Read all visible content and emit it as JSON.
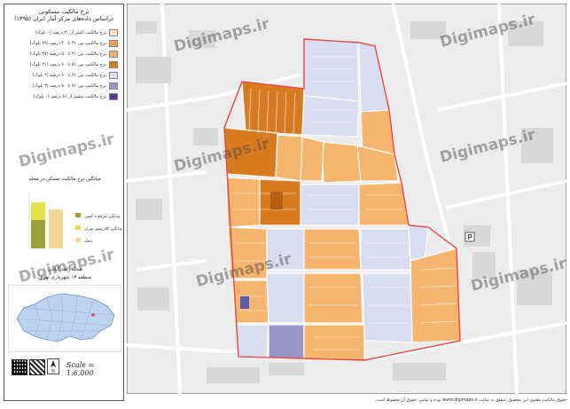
{
  "legend": {
    "title_line1": "نرخ مالکیت مسکونی",
    "title_line2": "دراساس داده‌های مرکز آمار ایران (۱۳۹۵)",
    "items": [
      {
        "label": "نرخ مالکیت کمتر از ۳۰ درصد (۰ بلوک)",
        "color": "#f7e3c4"
      },
      {
        "label": "نرخ مالکیت بین ۳۱ تا ۴۰ درصد (۲۹ بلوک)",
        "color": "#f2a24e"
      },
      {
        "label": "نرخ مالکیت بین ۴۱ تا ۵۰ درصد (۴۷ بلوک)",
        "color": "#f6b56f"
      },
      {
        "label": "نرخ مالکیت بین ۵۱ تا ۶۰ درصد (۲۱ بلوک)",
        "color": "#d77a20"
      },
      {
        "label": "نرخ مالکیت بین ۶۱ تا ۶۰ درصد (۲ بلوک)",
        "color": "#dadcf0"
      },
      {
        "label": "نرخ مالکیت بین ۷۱ تا ۸۰ درصد (۳ بلوک)",
        "color": "#9b95c8"
      },
      {
        "label": "نرخ مالکیت بیشتر از ۸۱ درصد (۰ بلوک)",
        "color": "#5a3a8c"
      }
    ],
    "chart_title": "میانگین نرخ مالکیت مسکن در محله",
    "chart_legend": [
      {
        "label": "میانگین مرجع با کسی",
        "color": "#9aa13a"
      },
      {
        "label": "میانگین کلان‌شهر تهران",
        "color": "#e2e34a"
      },
      {
        "label": "محله",
        "color": "#f5d79a"
      }
    ],
    "neighborhood_line1": "محله زاهد گیلانی",
    "neighborhood_line2": "منطقه ۱۳ شهرداری تهران",
    "scale": "Scale = 1:6,000"
  },
  "watermark": "Digimaps.ir",
  "footer": "حقوق مالکیت معنوی این محصول متعلق به سایت www.digimaps.ir بوده و تمامی حقوق آن محفوظ است.",
  "colors": {
    "light_orange": "#f6b56f",
    "dark_orange": "#d77a20",
    "lavender": "#dadcf0",
    "purple": "#9b95c8",
    "boundary": "#e8473f"
  }
}
